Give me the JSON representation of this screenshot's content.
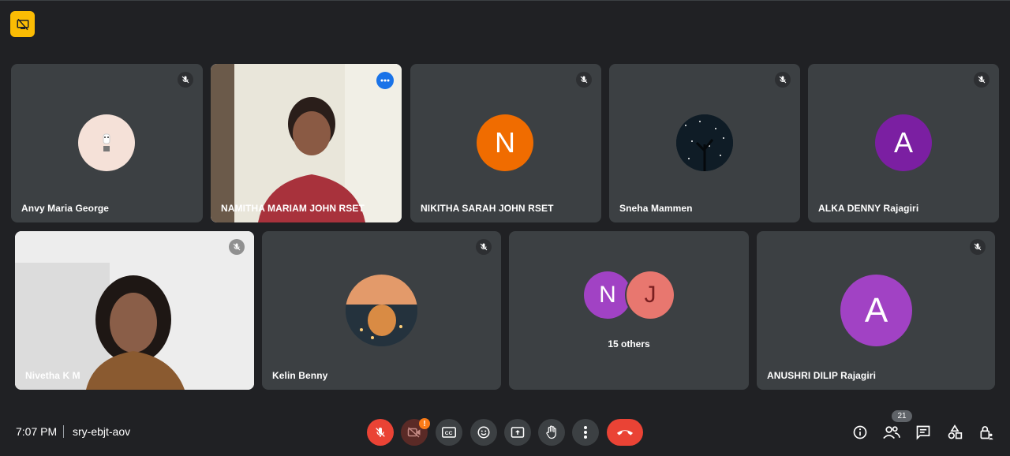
{
  "participants_row1": [
    {
      "name": "Anvy Maria George",
      "muted": true
    },
    {
      "name": "NAMITHA MARIAM JOHN RSET",
      "muted": false
    },
    {
      "name": "NIKITHA SARAH JOHN RSET",
      "initial": "N",
      "muted": true
    },
    {
      "name": "Sneha Mammen",
      "muted": true
    },
    {
      "name": "ALKA DENNY Rajagiri",
      "initial": "A",
      "muted": true
    }
  ],
  "participants_row2": [
    {
      "name": "Nivetha K M",
      "muted": true
    },
    {
      "name": "Kelin Benny",
      "muted": true
    },
    {
      "group_initials": [
        "N",
        "J"
      ],
      "label": "15 others"
    },
    {
      "name": "ANUSHRI DILIP Rajagiri",
      "initial": "A",
      "muted": true
    }
  ],
  "bottom_bar": {
    "time": "7:07 PM",
    "meeting_code": "sry-ebjt-aov",
    "camera_alert": "!",
    "people_count": "21"
  },
  "colors": {
    "background": "#202124",
    "tile": "#3c4043",
    "active_border": "#8ab4f8",
    "end_call": "#ea4335",
    "avatar_orange": "#f06c00",
    "avatar_purple": "#7b1fa2",
    "avatar_violet": "#a142c4",
    "avatar_pink": "#e8776f"
  }
}
